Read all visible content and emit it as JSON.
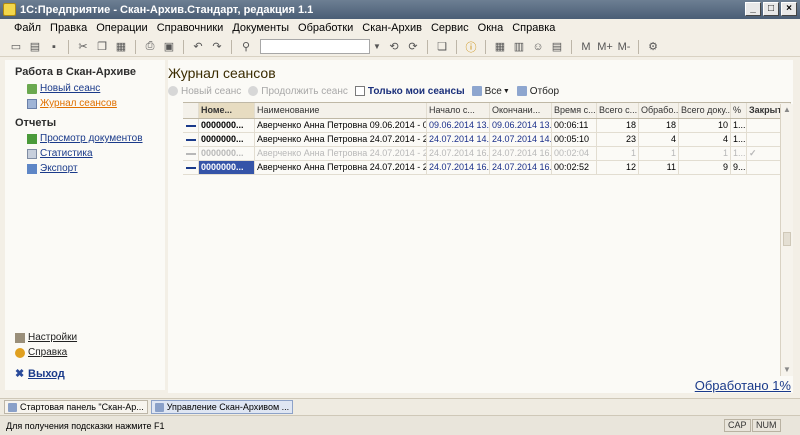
{
  "window": {
    "title": "1С:Предприятие - Скан-Архив.Стандарт, редакция 1.1"
  },
  "menu": [
    "Файл",
    "Правка",
    "Операции",
    "Справочники",
    "Документы",
    "Обработки",
    "Скан-Архив",
    "Сервис",
    "Окна",
    "Справка"
  ],
  "sidebar": {
    "section1": "Работа в Скан-Архиве",
    "items1": [
      {
        "label": "Новый сеанс",
        "icon": "new-session-icon"
      },
      {
        "label": "Журнал сеансов",
        "icon": "journal-icon",
        "active": true
      }
    ],
    "section2": "Отчеты",
    "items2": [
      {
        "label": "Просмотр документов",
        "icon": "documents-icon"
      },
      {
        "label": "Статистика",
        "icon": "statistics-icon"
      },
      {
        "label": "Экспорт",
        "icon": "export-icon"
      }
    ],
    "settings": "Настройки",
    "help": "Справка",
    "exit": "Выход"
  },
  "main": {
    "title": "Журнал сеансов",
    "cmd_new": "Новый сеанс",
    "cmd_continue": "Продолжить сеанс",
    "cmd_mine": "Только мои сеансы",
    "cmd_all": "Все",
    "cmd_filter": "Отбор"
  },
  "grid": {
    "headers": [
      "Номе...",
      "Наименование",
      "Начало с...",
      "Окончани...",
      "Время с...",
      "Всего с...",
      "Обрабо...",
      "Всего доку...",
      "%",
      "Закрыт"
    ],
    "rows": [
      {
        "num": "0000000...",
        "name": "Аверченко Анна Петровна 09.06.2014 - 09.0...",
        "start": "09.06.2014 13...",
        "end": "09.06.2014 13...",
        "time": "00:06:11",
        "total": "18",
        "processed": "18",
        "docs": "10",
        "pct": "1...",
        "closed": ""
      },
      {
        "num": "0000000...",
        "name": "Аверченко Анна Петровна 24.07.2014 - 24.0...",
        "start": "24.07.2014 14...",
        "end": "24.07.2014 14...",
        "time": "00:05:10",
        "total": "23",
        "processed": "4",
        "docs": "4",
        "pct": "1...",
        "closed": ""
      },
      {
        "num": "0000000...",
        "name": "Аверченко Анна Петровна 24.07.2014 - 24.0...",
        "start": "24.07.2014 16...",
        "end": "24.07.2014 16...",
        "time": "00:02:04",
        "total": "1",
        "processed": "1",
        "docs": "1",
        "pct": "1...",
        "closed": "✓"
      },
      {
        "num": "0000000...",
        "name": "Аверченко Анна Петровна 24.07.2014 - 24.0...",
        "start": "24.07.2014 16...",
        "end": "24.07.2014 16...",
        "time": "00:02:52",
        "total": "12",
        "processed": "11",
        "docs": "9",
        "pct": "9...",
        "closed": ""
      }
    ]
  },
  "processed_label": "Обработано 1%",
  "taskbar": [
    "Стартовая панель \"Скан-Ар...",
    "Управление Скан-Архивом ..."
  ],
  "status": {
    "hint": "Для получения подсказки нажмите F1",
    "cap": "CAP",
    "num": "NUM"
  }
}
